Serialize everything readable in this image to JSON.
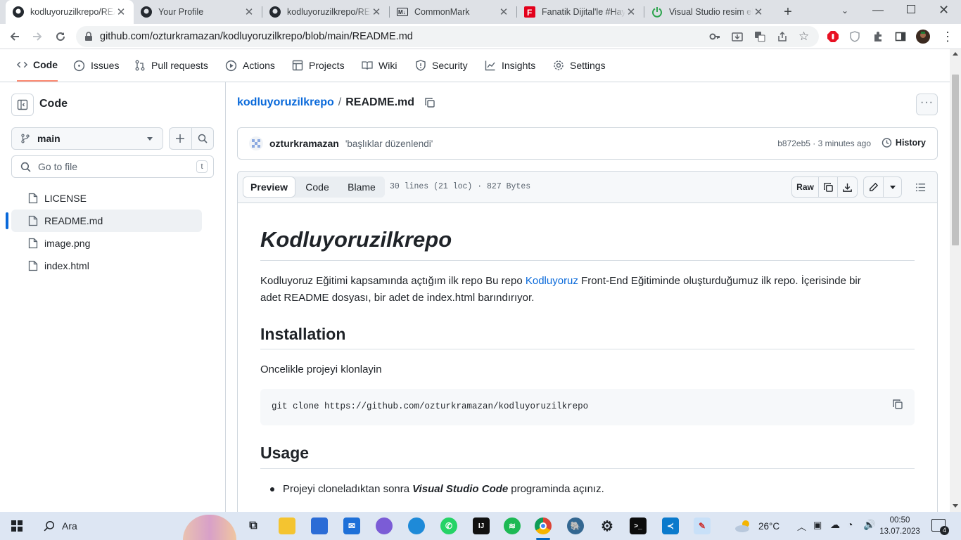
{
  "browser": {
    "tabs": [
      {
        "title": "kodluyoruzilkrepo/README.md",
        "icon": "github-icon",
        "active": true
      },
      {
        "title": "Your Profile",
        "icon": "github-icon"
      },
      {
        "title": "kodluyoruzilkrepo/README.md",
        "icon": "github-icon"
      },
      {
        "title": "CommonMark",
        "icon": "markdown-icon"
      },
      {
        "title": "Fanatik Dijital'le #Hayatımızda",
        "icon": "fanatik-icon"
      },
      {
        "title": "Visual Studio resim ekleme",
        "icon": "power-icon"
      }
    ],
    "url": "github.com/ozturkramazan/kodluyoruzilkrepo/blob/main/README.md"
  },
  "repo_nav": [
    {
      "label": "Code",
      "icon": "code-icon",
      "selected": true
    },
    {
      "label": "Issues",
      "icon": "issue-icon"
    },
    {
      "label": "Pull requests",
      "icon": "pull-request-icon"
    },
    {
      "label": "Actions",
      "icon": "play-icon"
    },
    {
      "label": "Projects",
      "icon": "table-icon"
    },
    {
      "label": "Wiki",
      "icon": "book-icon"
    },
    {
      "label": "Security",
      "icon": "shield-icon"
    },
    {
      "label": "Insights",
      "icon": "graph-icon"
    },
    {
      "label": "Settings",
      "icon": "gear-icon"
    }
  ],
  "sidebar": {
    "title": "Code",
    "branch": "main",
    "goto_placeholder": "Go to file",
    "goto_shortcut": "t",
    "files": [
      {
        "name": "LICENSE",
        "selected": false
      },
      {
        "name": "README.md",
        "selected": true
      },
      {
        "name": "image.png",
        "selected": false
      },
      {
        "name": "index.html",
        "selected": false
      }
    ]
  },
  "file": {
    "repo": "kodluyoruzilkrepo",
    "sep": "/",
    "name": "README.md",
    "author": "ozturkramazan",
    "commit_msg": "'başlıklar düzenlendi'",
    "commit_meta": "b872eb5 · 3 minutes ago",
    "history_label": "History",
    "view_tabs": [
      "Preview",
      "Code",
      "Blame"
    ],
    "stats": "30 lines (21 loc) · 827 Bytes",
    "raw_label": "Raw"
  },
  "readme": {
    "h1": "Kodluyoruzilkrepo",
    "p1_before": "Kodluyoruz Eğitimi kapsamında açtığım ilk repo Bu repo ",
    "p1_link": "Kodluyoruz",
    "p1_after_line1": " Front-End Eğitiminde oluşturduğumuz ilk repo. İçerisinde bir",
    "p1_line2": "adet README dosyası, bir adet de index.html barındırıyor.",
    "h2_install": "Installation",
    "p_install": "Oncelikle projeyi klonlayin",
    "code": "git clone https://github.com/ozturkramazan/kodluyoruzilkrepo",
    "h2_usage": "Usage",
    "usage_before": "Projeyi cloneladıktan sonra ",
    "usage_em": "Visual Studio Code",
    "usage_after": " programinda açınız."
  },
  "taskbar": {
    "search_label": "Ara",
    "weather": "26°C",
    "time": "00:50",
    "date": "13.07.2023",
    "notif_count": "4"
  },
  "colors": {
    "accent": "#0969da",
    "nav_underline": "#fd8c73",
    "sidebar_selected": "#0969da"
  }
}
